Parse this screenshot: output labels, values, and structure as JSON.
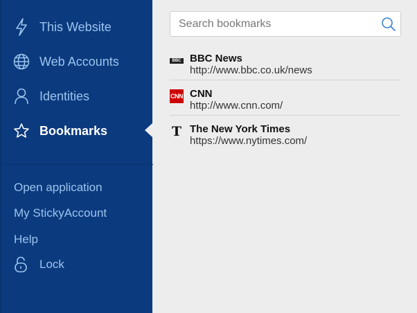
{
  "sidebar": {
    "nav": [
      {
        "label": "This Website",
        "icon": "lightning-icon",
        "active": false
      },
      {
        "label": "Web Accounts",
        "icon": "globe-icon",
        "active": false
      },
      {
        "label": "Identities",
        "icon": "person-icon",
        "active": false
      },
      {
        "label": "Bookmarks",
        "icon": "star-icon",
        "active": true
      }
    ],
    "links": [
      {
        "label": "Open application"
      },
      {
        "label": "My StickyAccount"
      },
      {
        "label": "Help"
      }
    ],
    "lock": {
      "label": "Lock",
      "icon": "lock-icon"
    }
  },
  "search": {
    "placeholder": "Search bookmarks",
    "value": ""
  },
  "bookmarks": [
    {
      "title": "BBC News",
      "url": "http://www.bbc.co.uk/news",
      "logo": "bbc-logo-icon",
      "logo_text": "BBC"
    },
    {
      "title": "CNN",
      "url": "http://www.cnn.com/",
      "logo": "cnn-logo-icon",
      "logo_text": "CNN"
    },
    {
      "title": "The New York Times",
      "url": "https://www.nytimes.com/",
      "logo": "nyt-logo-icon",
      "logo_text": "T"
    }
  ],
  "colors": {
    "sidebar_bg": "#0b3a7e",
    "sidebar_text": "#9cc4ee",
    "sidebar_active_text": "#ffffff",
    "content_bg": "#ededed",
    "cnn_red": "#cc0000"
  }
}
